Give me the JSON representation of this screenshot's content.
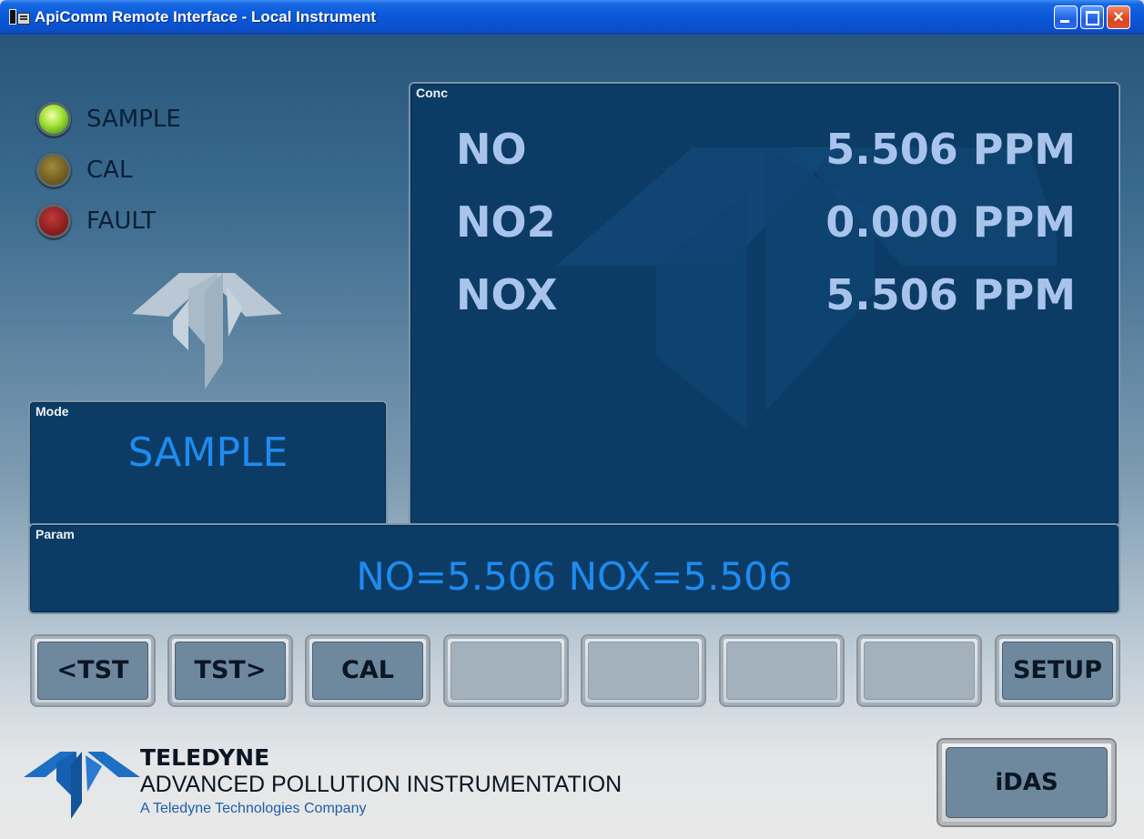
{
  "window": {
    "title": "ApiComm Remote Interface - Local Instrument",
    "close_glyph": "×"
  },
  "status_leds": [
    {
      "label": "SAMPLE",
      "state": "on",
      "color": "#7ed321"
    },
    {
      "label": "CAL",
      "state": "off",
      "color": "#6f5c1f"
    },
    {
      "label": "FAULT",
      "state": "off",
      "color": "#8a1c1c"
    }
  ],
  "mode": {
    "label": "Mode",
    "value": "SAMPLE"
  },
  "conc": {
    "label": "Conc",
    "rows": [
      {
        "name": "NO",
        "value": "5.506 PPM"
      },
      {
        "name": "NO2",
        "value": "0.000 PPM"
      },
      {
        "name": "NOX",
        "value": "5.506 PPM"
      }
    ]
  },
  "param": {
    "label": "Param",
    "value": "NO=5.506 NOX=5.506"
  },
  "function_keys": [
    "<TST",
    "TST>",
    "CAL",
    "",
    "",
    "",
    "",
    "SETUP"
  ],
  "company": {
    "name": "TELEDYNE",
    "division": "ADVANCED POLLUTION INSTRUMENTATION",
    "parent": "A Teledyne Technologies Company"
  },
  "idas_button": {
    "label": "iDAS"
  },
  "colors": {
    "panel_bg": "#0c3c65",
    "conc_text": "#a9c4ec",
    "value_text": "#1f8bf0",
    "titlebar": "#0a57d8"
  },
  "icons": [
    "app-icon",
    "minimize-icon",
    "maximize-icon",
    "close-icon",
    "teledyne-logo-icon"
  ]
}
